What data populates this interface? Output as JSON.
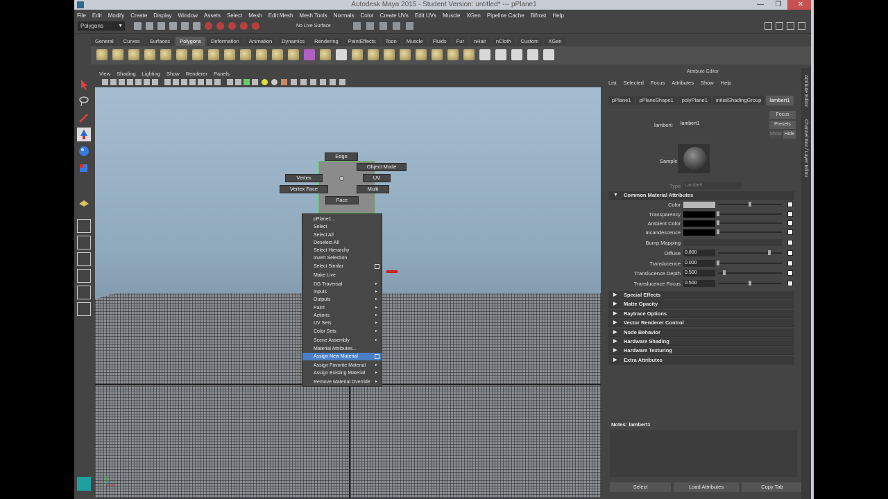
{
  "window": {
    "title": "Autodesk Maya 2015 - Student Version: untitled*   ---   pPlane1",
    "controls": [
      "—",
      "❐",
      "✕"
    ]
  },
  "menubar": [
    "File",
    "Edit",
    "Modify",
    "Create",
    "Display",
    "Window",
    "Assets",
    "Select",
    "Mesh",
    "Edit Mesh",
    "Mesh Tools",
    "Normals",
    "Color",
    "Create UVs",
    "Edit UVs",
    "Muscle",
    "XGen",
    "Pipeline Cache",
    "Bifrost",
    "Help"
  ],
  "status_line": {
    "mode": "Polygons",
    "live_surface": "No Live Surface"
  },
  "shelf_tabs": [
    "General",
    "Curves",
    "Surfaces",
    "Polygons",
    "Deformation",
    "Animation",
    "Dynamics",
    "Rendering",
    "PaintEffects",
    "Toon",
    "Muscle",
    "Fluids",
    "Fur",
    "nHair",
    "nCloth",
    "Custom",
    "XGen"
  ],
  "panel_menu": [
    "View",
    "Shading",
    "Lighting",
    "Show",
    "Renderer",
    "Panels"
  ],
  "marking_menu": {
    "north": "Edge",
    "northeast": "Object Mode",
    "west": "Vertex",
    "east": "UV",
    "southwest": "Vertex Face",
    "southeast": "Multi",
    "south": "Face"
  },
  "context_menu": [
    {
      "label": "pPlane1...",
      "sub": false
    },
    {
      "label": "Select",
      "sub": false
    },
    {
      "label": "Select All",
      "sub": false
    },
    {
      "label": "Deselect All",
      "sub": false
    },
    {
      "label": "Select Hierarchy",
      "sub": false
    },
    {
      "label": "Invert Selection",
      "sub": false
    },
    {
      "label": "Select Similar",
      "sub": false,
      "box": true
    },
    {
      "label": "Make Live",
      "sub": false
    },
    {
      "label": "DG Traversal",
      "sub": true
    },
    {
      "label": "Inputs",
      "sub": true
    },
    {
      "label": "Outputs",
      "sub": true
    },
    {
      "label": "Paint",
      "sub": true
    },
    {
      "label": "Actions",
      "sub": true
    },
    {
      "label": "UV Sets",
      "sub": true
    },
    {
      "label": "Color Sets",
      "sub": true
    },
    {
      "label": "Scene Assembly",
      "sub": true
    },
    {
      "label": "Material Attributes...",
      "sub": false
    },
    {
      "label": "Assign New Material",
      "sub": false,
      "box": true,
      "highlighted": true
    },
    {
      "label": "Assign Favorite Material",
      "sub": true
    },
    {
      "label": "Assign Existing Material",
      "sub": true
    },
    {
      "label": "Remove Material Override",
      "sub": true
    }
  ],
  "attribute_editor": {
    "title": "Attribute Editor",
    "menu": [
      "List",
      "Selected",
      "Focus",
      "Attributes",
      "Show",
      "Help"
    ],
    "tabs": [
      "pPlane1",
      "pPlaneShape1",
      "polyPlane1",
      "initialShadingGroup",
      "lambert1"
    ],
    "active_tab": "lambert1",
    "node_label": "lambert:",
    "node_value": "lambert1",
    "buttons": {
      "focus": "Focus",
      "presets": "Presets",
      "show": "Show",
      "hide": "Hide"
    },
    "sample_label": "Sample",
    "type_label": "Type",
    "type_value": "Lambert",
    "common_section": "Common Material Attributes",
    "attrs": [
      {
        "label": "Color",
        "value": "",
        "swatch": "#b8b8b8",
        "slider": 0.5
      },
      {
        "label": "Transparency",
        "value": "",
        "swatch": "#000000",
        "slider": 0.0
      },
      {
        "label": "Ambient Color",
        "value": "",
        "swatch": "#000000",
        "slider": 0.0
      },
      {
        "label": "Incandescence",
        "value": "",
        "swatch": "#000000",
        "slider": 0.0
      },
      {
        "label": "Bump Mapping",
        "value": "",
        "swatch": "",
        "slider": null
      },
      {
        "label": "Diffuse",
        "value": "0.800",
        "swatch": "",
        "slider": 0.8
      },
      {
        "label": "Translucence",
        "value": "0.000",
        "swatch": "",
        "slider": 0.0
      },
      {
        "label": "Translucence Depth",
        "value": "0.500",
        "swatch": "",
        "slider": 0.1
      },
      {
        "label": "Translucence Focus",
        "value": "0.500",
        "swatch": "",
        "slider": 0.5
      }
    ],
    "sections": [
      "Special Effects",
      "Matte Opacity",
      "Raytrace Options",
      "Vector Renderer Control",
      "Node Behavior",
      "Hardware Shading",
      "Hardware Texturing",
      "Extra Attributes"
    ],
    "notes_label": "Notes:  lambert1",
    "bottom_buttons": [
      "Select",
      "Load Attributes",
      "Copy Tab"
    ],
    "side_tabs": [
      "Attribute Editor",
      "Channel Box / Layer Editor"
    ]
  }
}
